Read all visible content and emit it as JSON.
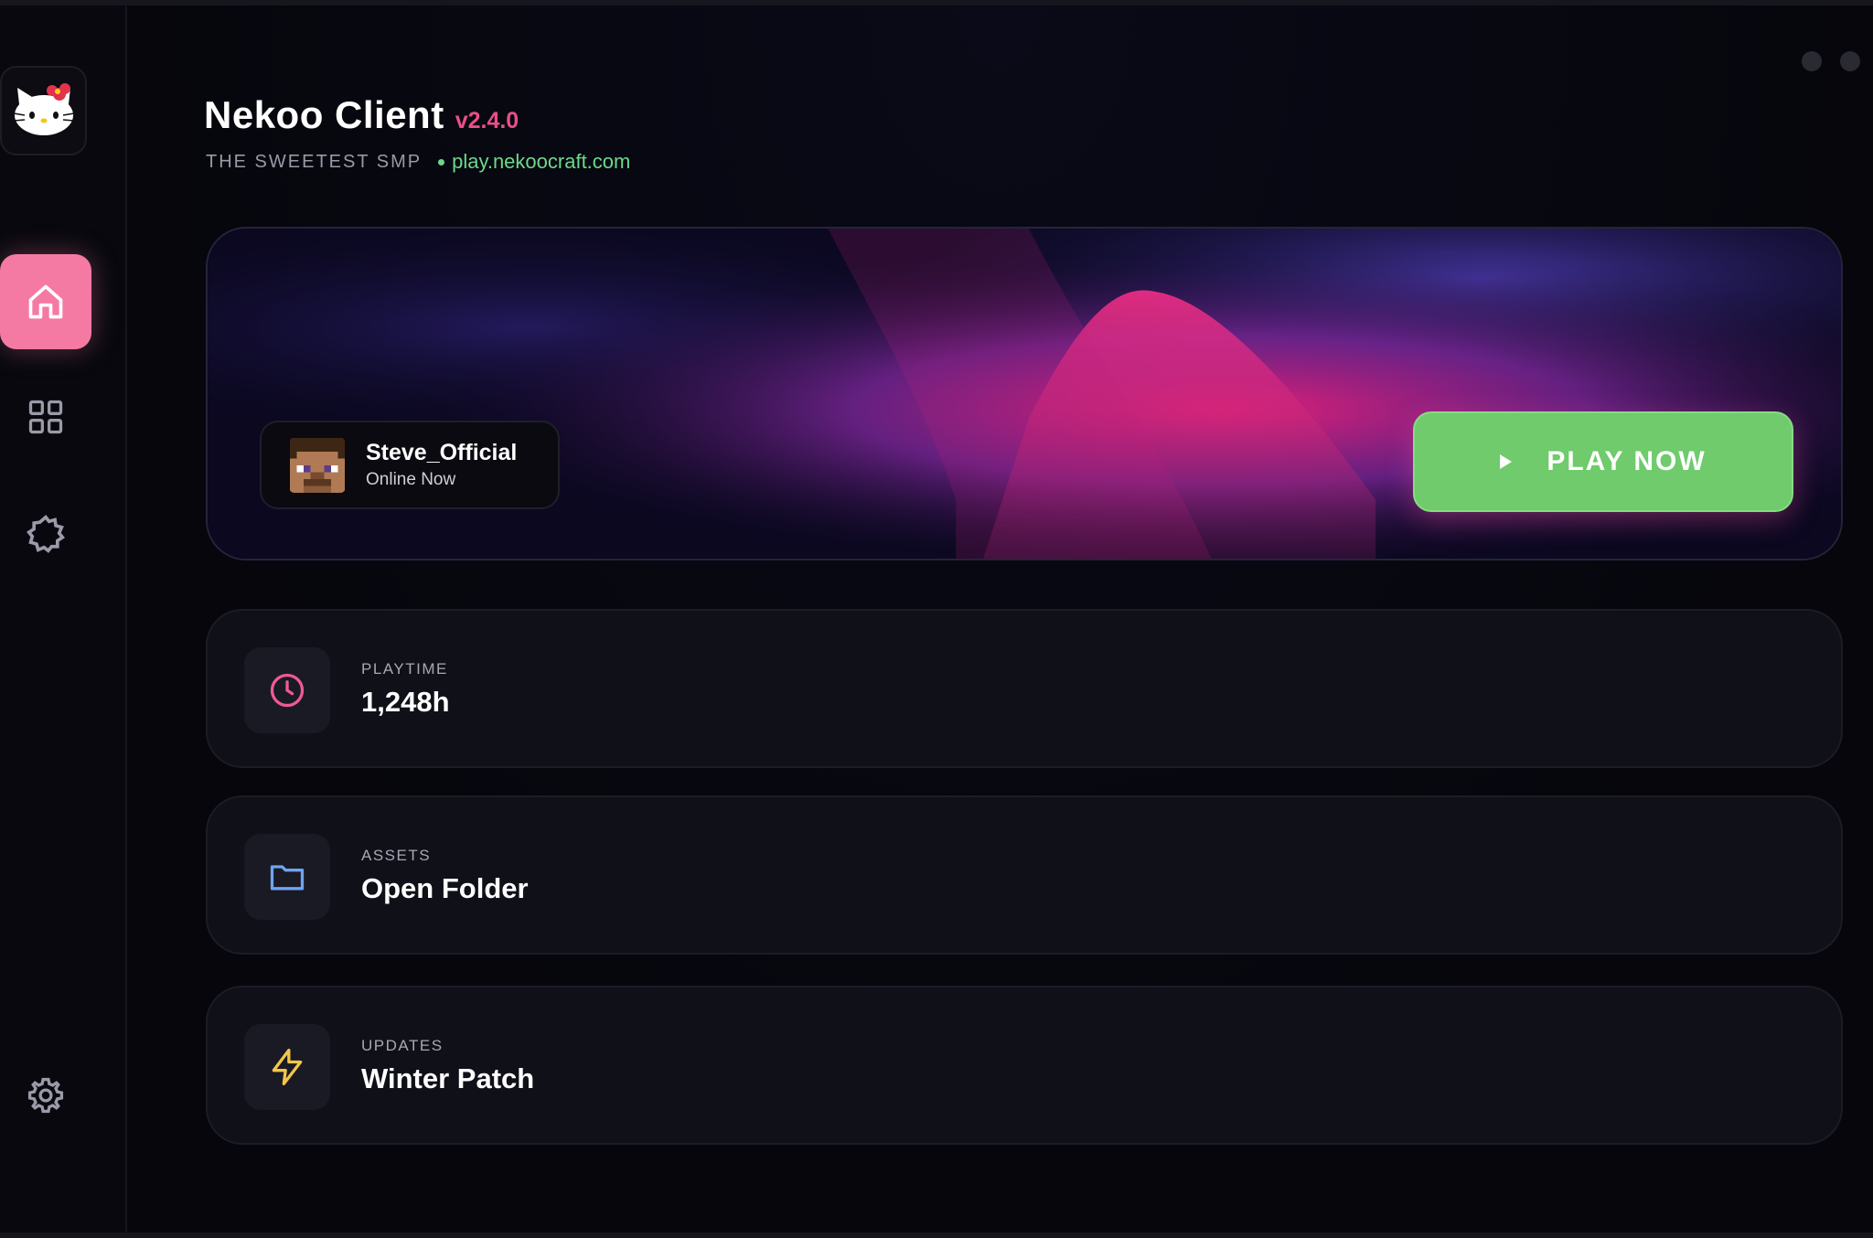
{
  "app": {
    "title": "Nekoo Client",
    "version": "v2.4.0",
    "tagline": "THE SWEETEST SMP",
    "server": "play.nekoocraft.com"
  },
  "sidebar": {
    "items": [
      {
        "name": "home",
        "icon": "home-icon",
        "active": true
      },
      {
        "name": "grid",
        "icon": "grid-icon",
        "active": false
      },
      {
        "name": "mods",
        "icon": "gear-outline-icon",
        "active": false
      },
      {
        "name": "settings",
        "icon": "settings-icon",
        "active": false
      }
    ]
  },
  "hero": {
    "username": "Steve_Official",
    "status": "Online Now",
    "play_label": "PLAY NOW"
  },
  "cards": [
    {
      "label": "PLAYTIME",
      "value": "1,248h",
      "icon": "clock-icon"
    },
    {
      "label": "ASSETS",
      "value": "Open Folder",
      "icon": "folder-icon"
    },
    {
      "label": "UPDATES",
      "value": "Winter Patch",
      "icon": "bolt-icon"
    }
  ],
  "colors": {
    "accent_pink": "#f57aa3",
    "version_pink": "#e94f87",
    "server_green": "#6cd98a",
    "play_green": "#6fcb6b"
  }
}
